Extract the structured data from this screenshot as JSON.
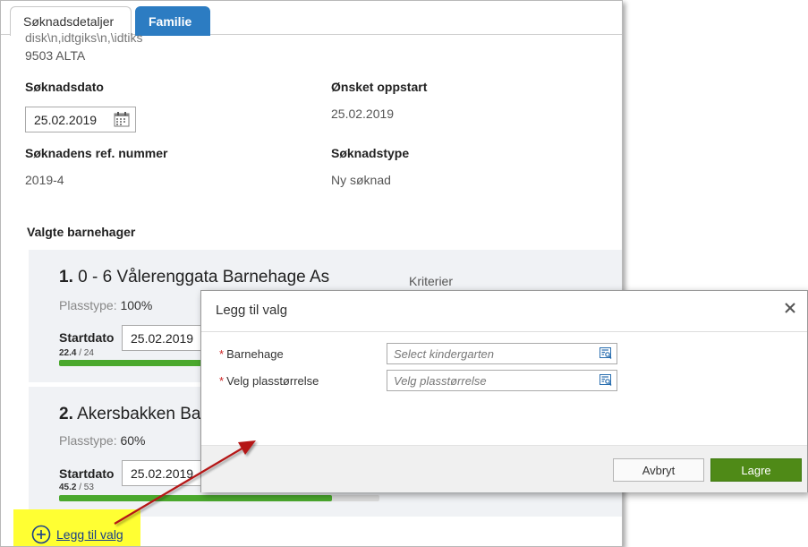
{
  "tabs": [
    {
      "label": "Søknadsdetaljer",
      "active": false
    },
    {
      "label": "Familie",
      "active": true
    }
  ],
  "address": {
    "line1": "disk\\n,idtgiks\\n,\\idtiks",
    "line2": "9503 ALTA"
  },
  "fields": {
    "soknadsdato_label": "Søknadsdato",
    "soknadsdato_value": "25.02.2019",
    "onsket_oppstart_label": "Ønsket oppstart",
    "onsket_oppstart_value": "25.02.2019",
    "ref_label": "Søknadens ref. nummer",
    "ref_value": "2019-4",
    "type_label": "Søknadstype",
    "type_value": "Ny søknad"
  },
  "valgte_barnehager": {
    "heading": "Valgte barnehager",
    "items": [
      {
        "number": "1.",
        "name": "0 - 6 Vålerenggata Barnehage As",
        "plasstype_label": "Plasstype:",
        "plasstype_value": "100%",
        "startdato_label": "Startdato",
        "startdato_value": "25.02.2019",
        "count_current": "22.4",
        "count_total": "/ 24",
        "progress": 0.933,
        "kriterier_label": "Kriterier"
      },
      {
        "number": "2.",
        "name": "Akersbakken Barnehage",
        "plasstype_label": "Plasstype:",
        "plasstype_value": "60%",
        "startdato_label": "Startdato",
        "startdato_value": "25.02.2019",
        "count_current": "45.2",
        "count_total": "/ 53",
        "progress": 0.853
      }
    ],
    "add_link": "Legg til valg"
  },
  "dialog": {
    "title": "Legg til valg",
    "fields": [
      {
        "label": "Barnehage",
        "required_mark": "*",
        "placeholder": "Select kindergarten"
      },
      {
        "label": "Velg plasstørrelse",
        "required_mark": "*",
        "placeholder": "Velg plasstørrelse"
      }
    ],
    "cancel_label": "Avbryt",
    "save_label": "Lagre"
  },
  "colors": {
    "accent_tab": "#2c7cc2",
    "save_button": "#4f8a17",
    "progress": "#4aa82d",
    "highlight": "#ffff33",
    "annotation_arrow": "#b51818"
  },
  "icons": {
    "calendar": "calendar-icon",
    "add": "plus-circle-icon",
    "close": "close-icon",
    "lookup": "search-list-icon"
  }
}
